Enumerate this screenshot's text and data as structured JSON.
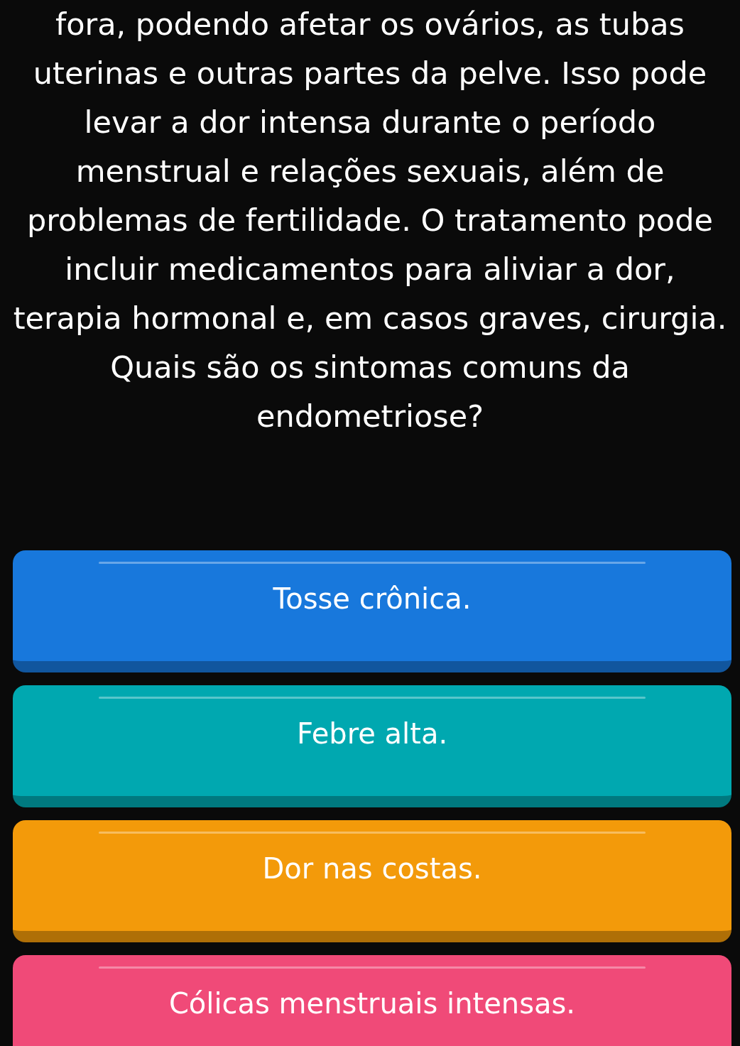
{
  "question": "fora, podendo afetar os ovários, as tubas uterinas e outras partes da pelve. Isso pode levar a dor intensa durante o período menstrual e relações sexuais, além de problemas de fertilidade. O tratamento pode incluir medicamentos para aliviar a dor, terapia hormonal e, em casos graves, cirurgia. Quais são os sintomas comuns da endometriose?",
  "answers": [
    {
      "label": "Tosse crônica.",
      "color": "#1878dc"
    },
    {
      "label": "Febre alta.",
      "color": "#00a8b0"
    },
    {
      "label": "Dor nas costas.",
      "color": "#f39a0a"
    },
    {
      "label": "Cólicas menstruais intensas.",
      "color": "#f04a78"
    }
  ]
}
